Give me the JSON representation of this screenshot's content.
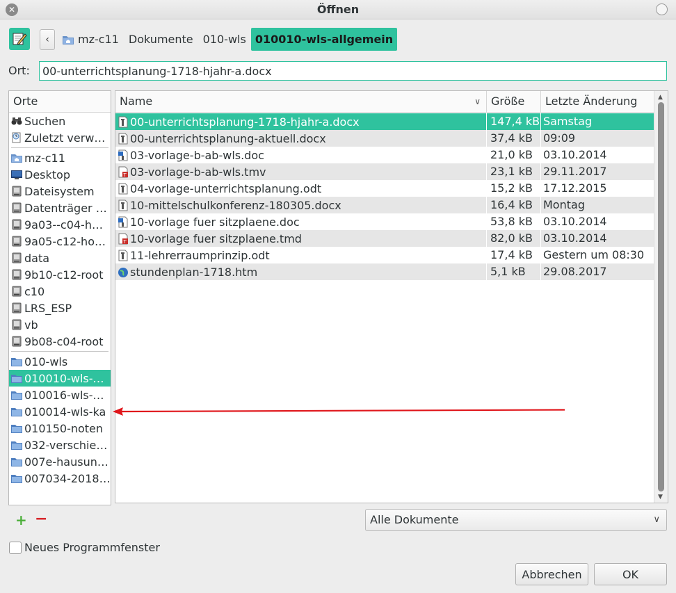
{
  "window": {
    "title": "Öffnen"
  },
  "toolbar": {
    "breadcrumbs": [
      "mz-c11",
      "Dokumente",
      "010-wls",
      "010010-wls-allgemein"
    ]
  },
  "location": {
    "label": "Ort:",
    "value": "00-unterrichtsplanung-1718-hjahr-a.docx"
  },
  "places": {
    "header": "Orte",
    "items": [
      "Suchen",
      "Zuletzt verw…",
      "mz-c11",
      "Desktop",
      "Dateisystem",
      "Datenträger …",
      "9a03--c04-h…",
      "9a05-c12-ho…",
      "data",
      "9b10-c12-root",
      "c10",
      "LRS_ESP",
      "vb",
      "9b08-c04-root",
      "010-wls",
      "010010-wls-…",
      "010016-wls-…",
      "010014-wls-ka",
      "010150-noten",
      "032-verschie…",
      "007e-hausun…",
      "007034-2018…"
    ]
  },
  "files": {
    "columns": {
      "name": "Name",
      "size": "Größe",
      "date": "Letzte Änderung"
    },
    "rows": [
      {
        "name": "00-unterrichtsplanung-1718-hjahr-a.docx",
        "size": "147,4 kB",
        "date": "Samstag"
      },
      {
        "name": "00-unterrichtsplanung-aktuell.docx",
        "size": "37,4 kB",
        "date": "09:09"
      },
      {
        "name": "03-vorlage-b-ab-wls.doc",
        "size": "21,0 kB",
        "date": "03.10.2014"
      },
      {
        "name": "03-vorlage-b-ab-wls.tmv",
        "size": "23,1 kB",
        "date": "29.11.2017"
      },
      {
        "name": "04-vorlage-unterrichtsplanung.odt",
        "size": "15,2 kB",
        "date": "17.12.2015"
      },
      {
        "name": "10-mittelschulkonferenz-180305.docx",
        "size": "16,4 kB",
        "date": "Montag"
      },
      {
        "name": "10-vorlage fuer sitzplaene.doc",
        "size": "53,8 kB",
        "date": "03.10.2014"
      },
      {
        "name": "10-vorlage fuer sitzplaene.tmd",
        "size": "82,0 kB",
        "date": "03.10.2014"
      },
      {
        "name": "11-lehrerraumprinzip.odt",
        "size": "17,4 kB",
        "date": "Gestern um 08:30"
      },
      {
        "name": "stundenplan-1718.htm",
        "size": "5,1 kB",
        "date": "29.08.2017"
      }
    ]
  },
  "filter": {
    "selected": "Alle Dokumente"
  },
  "options": {
    "new_window": "Neues Programmfenster"
  },
  "buttons": {
    "cancel": "Abbrechen",
    "ok": "OK"
  },
  "colors": {
    "accent": "#2fc29e",
    "annotation_arrow": "#e0161b"
  }
}
